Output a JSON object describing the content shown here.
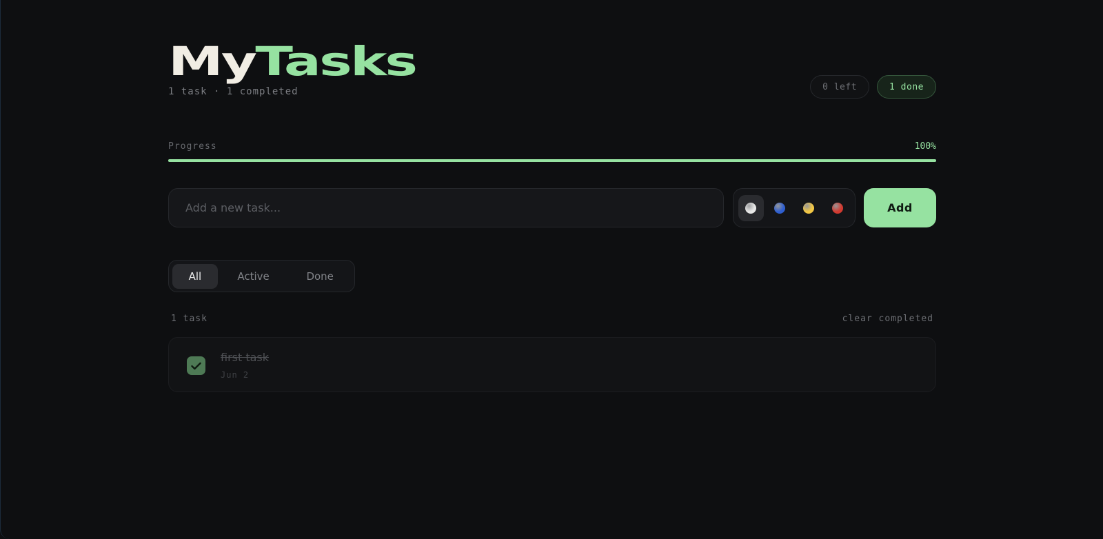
{
  "header": {
    "title_part1": "My",
    "title_part2": "Tasks",
    "subtitle": "1 task · 1 completed",
    "left_pill": "0 left",
    "done_pill": "1 done"
  },
  "progress": {
    "label": "Progress",
    "percent_text": "100%",
    "value": 1.0
  },
  "composer": {
    "placeholder": "Add a new task...",
    "colors": [
      {
        "name": "white",
        "hex": "#e8e8e8",
        "selected": true
      },
      {
        "name": "blue",
        "hex": "#2f5fd0",
        "selected": false
      },
      {
        "name": "yellow",
        "hex": "#f2c744",
        "selected": false
      },
      {
        "name": "red",
        "hex": "#d23a30",
        "selected": false
      }
    ],
    "add_label": "Add"
  },
  "filters": {
    "tabs": [
      "All",
      "Active",
      "Done"
    ],
    "active": "All"
  },
  "list": {
    "count_label": "1 task",
    "clear_label": "clear completed",
    "tasks": [
      {
        "text": "first task",
        "date": "Jun 2",
        "completed": true
      }
    ]
  },
  "accent": "#96e2a1"
}
